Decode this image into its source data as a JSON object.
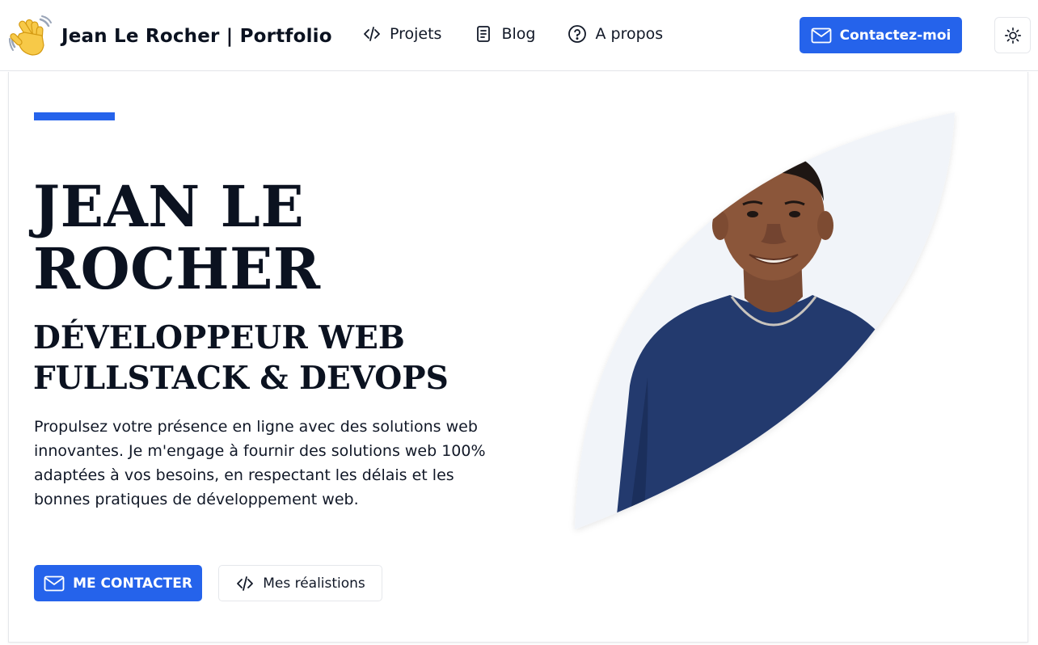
{
  "header": {
    "brand_emoji": "👋",
    "brand_title": "Jean Le Rocher | Portfolio",
    "nav": [
      {
        "label": "Projets",
        "icon": "code-icon"
      },
      {
        "label": "Blog",
        "icon": "document-icon"
      },
      {
        "label": "A propos",
        "icon": "question-circle-icon"
      }
    ],
    "contact_label": "Contactez-moi",
    "contact_icon": "mail-icon",
    "theme_icon": "sun-icon"
  },
  "hero": {
    "name": "JEAN LE ROCHER",
    "role": "DÉVELOPPEUR WEB FULLSTACK & DEVOPS",
    "description": "Propulsez votre présence en ligne avec des solutions web innovantes. Je m'engage à fournir des solutions web 100% adaptées à vos besoins, en respectant les délais et les bonnes pratiques de développement web.",
    "primary_button": "ME CONTACTER",
    "primary_icon": "mail-icon",
    "secondary_button": "Mes réalistions",
    "secondary_icon": "code-icon",
    "portrait_icon": "portrait-photo"
  },
  "colors": {
    "accent": "#2563eb",
    "text": "#0b1220",
    "border": "#e5e7eb",
    "leaf_bg": "#f1f4f9"
  }
}
